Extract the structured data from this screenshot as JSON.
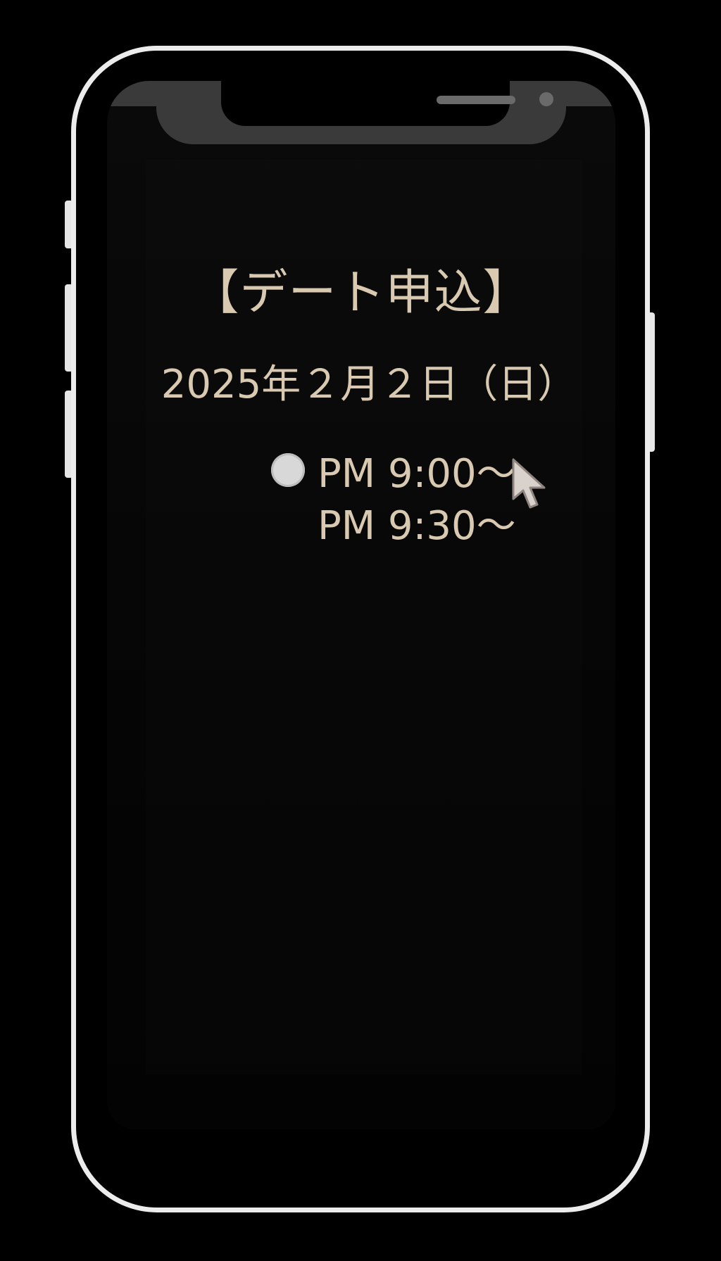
{
  "screen": {
    "title": "【デート申込】",
    "date": "2025年２月２日（日）",
    "time_slots": [
      {
        "label": "PM 9:00～",
        "selected": true
      },
      {
        "label": "PM 9:30～",
        "selected": false
      }
    ]
  },
  "colors": {
    "text": "#d8c9b0",
    "background": "#000000",
    "frame": "#ececec",
    "notch": "#3a3a3a",
    "radio": "#d8d8d8"
  },
  "icons": {
    "cursor": "mouse-pointer-icon",
    "radio": "radio-button-icon"
  }
}
